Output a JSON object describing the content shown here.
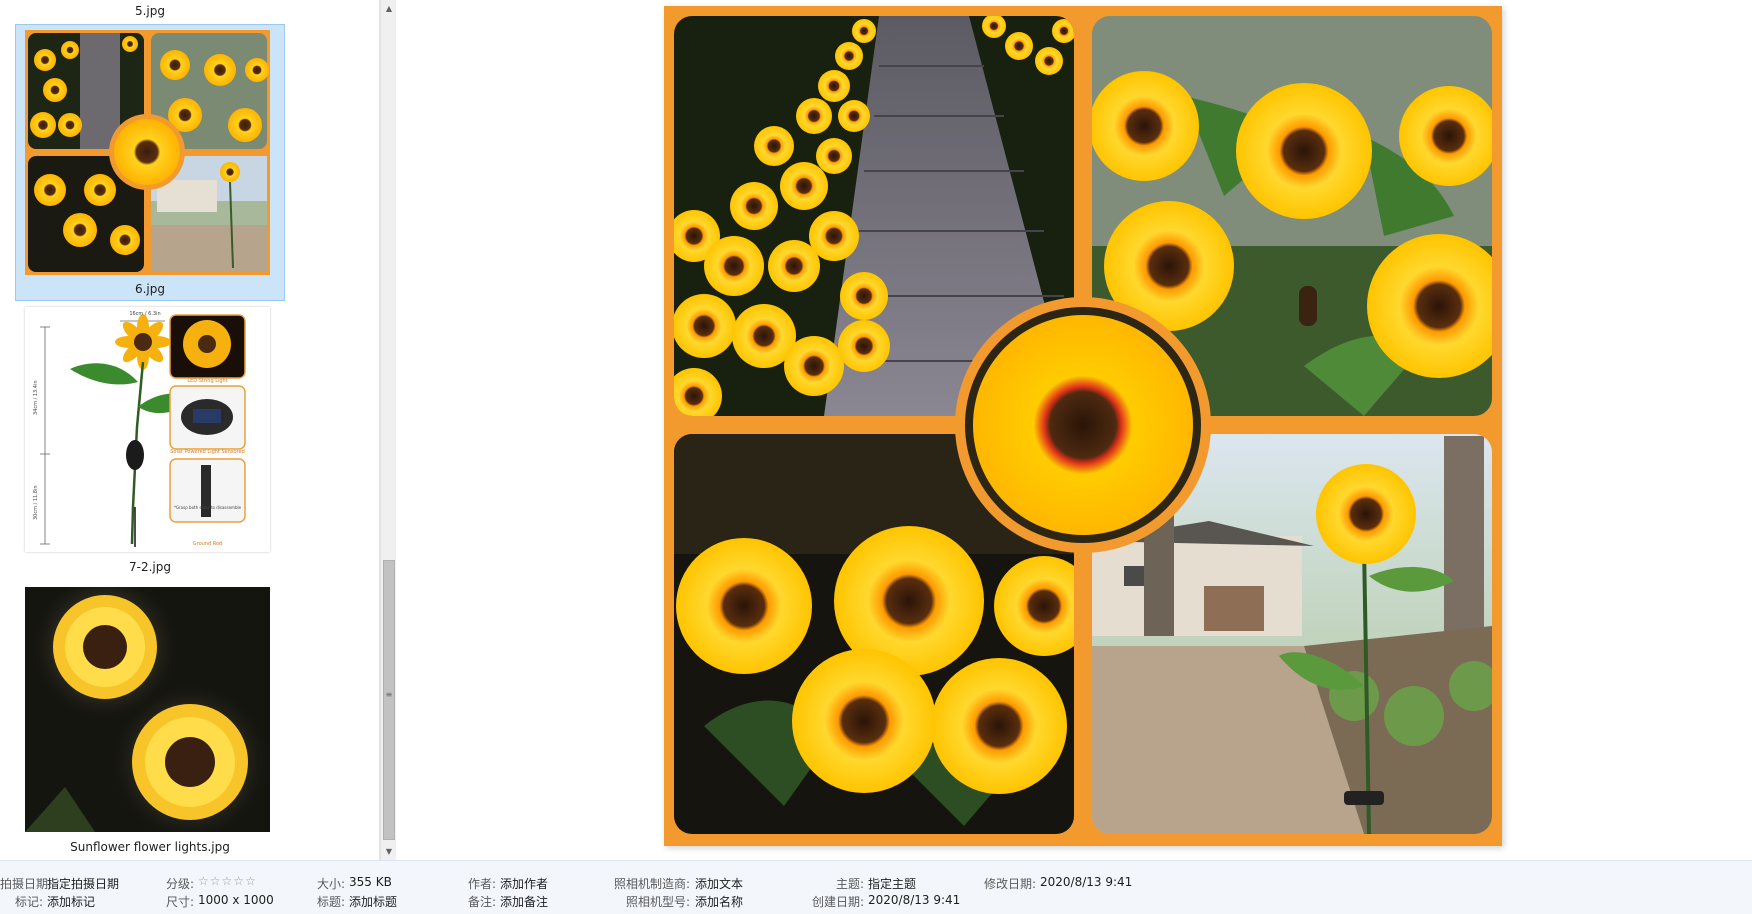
{
  "thumbnails": [
    {
      "name": "5.jpg"
    },
    {
      "name": "6.jpg",
      "selected": true
    },
    {
      "name": "7-2.jpg"
    },
    {
      "name": "Sunflower flower lights.jpg"
    }
  ],
  "product_diagram": {
    "dim_width": "16cm / 6.3in",
    "dim_upper": "34cm / 13.4in",
    "dim_lower": "30cm / 11.8in",
    "callouts": [
      "LED String Light",
      "Solar Powered Light Sensored",
      "Ground Rod"
    ],
    "note": "*Grasp both sides to disassemble"
  },
  "details": {
    "date_taken_label": "拍摄日期:",
    "date_taken_value": "指定拍摄日期",
    "tags_label": "标记:",
    "tags_value": "添加标记",
    "rating_label": "分级:",
    "rating_stars": 0,
    "size_label": "大小:",
    "size_value": "355 KB",
    "dimensions_label": "尺寸:",
    "dimensions_value": "1000 x 1000",
    "title_label": "标题:",
    "title_value": "添加标题",
    "author_label": "作者:",
    "author_value": "添加作者",
    "comments_label": "备注:",
    "comments_value": "添加备注",
    "camera_maker_label": "照相机制造商:",
    "camera_maker_value": "添加文本",
    "camera_model_label": "照相机型号:",
    "camera_model_value": "添加名称",
    "subject_label": "主题:",
    "subject_value": "指定主题",
    "created_label": "创建日期:",
    "created_value": "2020/8/13 9:41",
    "modified_label": "修改日期:",
    "modified_value": "2020/8/13 9:41"
  },
  "colors": {
    "frame_orange": "#f39a2e",
    "selection_blue": "#cce4f7",
    "details_bg": "#f3f7fc"
  }
}
